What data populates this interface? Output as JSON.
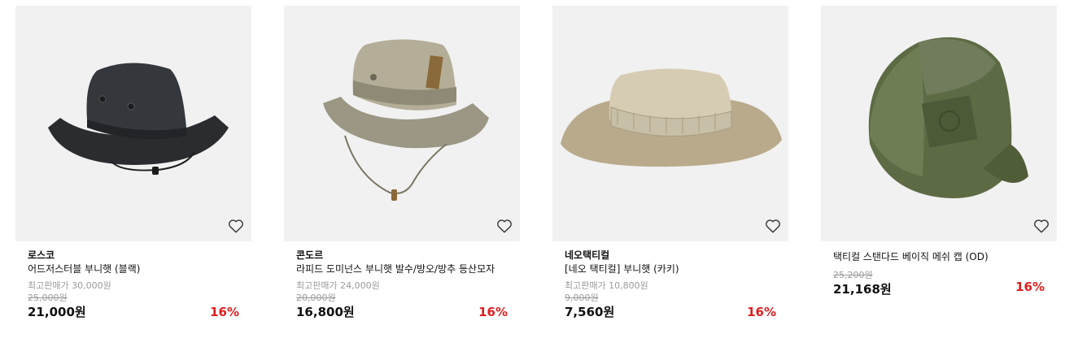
{
  "products": [
    {
      "brand": "로스코",
      "name": "어드저스터블 부니햇 (블랙)",
      "max_price": "최고판매가 30,000원",
      "original_price": "25,000원",
      "price": "21,000원",
      "discount": "16%",
      "image": "black-boonie-hat"
    },
    {
      "brand": "콘도르",
      "name": "라피드 도미넌스 부니햇 발수/방오/방추 등산모자",
      "max_price": "최고판매가 24,000원",
      "original_price": "20,000원",
      "price": "16,800원",
      "discount": "16%",
      "image": "khaki-boonie-hat"
    },
    {
      "brand": "네오택티컬",
      "name": "[네오 택티컬] 부니햇 (카키)",
      "max_price": "최고판매가 10,800원",
      "original_price": "9,000원",
      "price": "7,560원",
      "discount": "16%",
      "image": "khaki-mesh-boonie-hat"
    },
    {
      "brand": "",
      "name": "택티컬 스탠다드 베이직 메쉬 캡 (OD)",
      "max_price": "",
      "original_price": "25,200원",
      "price": "21,168원",
      "discount": "16%",
      "image": "olive-mesh-cap"
    }
  ],
  "colors": {
    "image_bg": "#f1f1f1",
    "discount": "#e01e1e",
    "muted": "#9a9a9a"
  },
  "icons": {
    "wishlist": "heart-outline-icon"
  }
}
